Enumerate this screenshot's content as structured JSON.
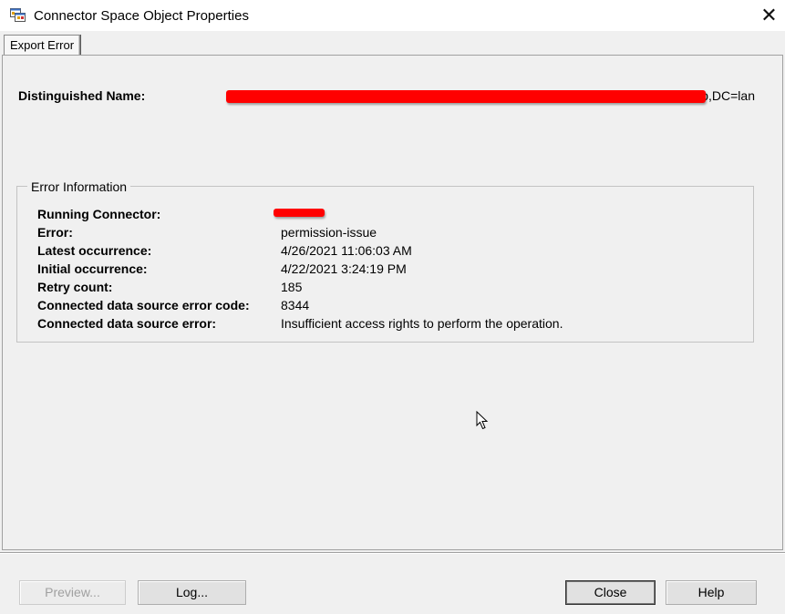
{
  "window": {
    "title": "Connector Space Object Properties",
    "close_glyph": "✕",
    "icon": "app-window-icon"
  },
  "tabs": [
    {
      "label": "Export Error",
      "selected": true
    }
  ],
  "distinguished_name": {
    "label": "Distinguished Name:",
    "value_visible_suffix": "o,DC=lan"
  },
  "error_information": {
    "title": "Error Information",
    "rows": [
      {
        "label": "Running Connector:",
        "value": ""
      },
      {
        "label": "Error:",
        "value": "permission-issue"
      },
      {
        "label": "Latest occurrence:",
        "value": "4/26/2021 11:06:03 AM"
      },
      {
        "label": "Initial occurrence:",
        "value": "4/22/2021 3:24:19 PM"
      },
      {
        "label": "Retry count:",
        "value": "185"
      },
      {
        "label": "Connected data source error code:",
        "value": "8344"
      },
      {
        "label": "Connected data source error:",
        "value": "Insufficient access rights to perform the operation."
      }
    ]
  },
  "buttons": {
    "preview": "Preview...",
    "log": "Log...",
    "close": "Close",
    "help": "Help"
  },
  "colors": {
    "redaction": "#ff0000",
    "window_bg": "#f0f0f0",
    "titlebar_bg": "#ffffff"
  }
}
